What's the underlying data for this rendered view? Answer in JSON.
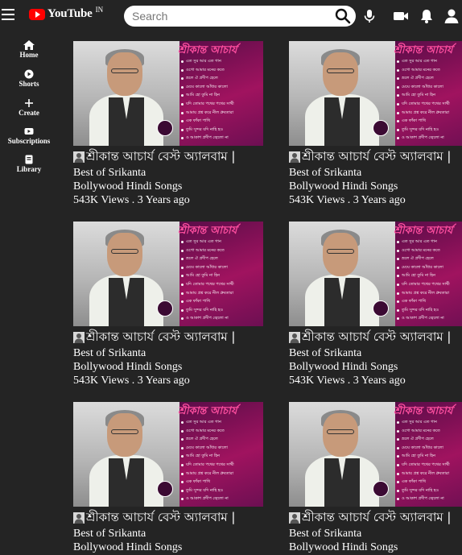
{
  "header": {
    "logo_text": "YouTube",
    "region": "IN",
    "search_placeholder": "Search"
  },
  "sidebar": {
    "items": [
      {
        "label": "Home",
        "icon": "home-icon"
      },
      {
        "label": "Shorts",
        "icon": "shorts-icon"
      },
      {
        "label": "Create",
        "icon": "create-icon"
      },
      {
        "label": "Subscriptions",
        "icon": "subscriptions-icon"
      },
      {
        "label": "Library",
        "icon": "library-icon"
      }
    ]
  },
  "thumbnail_text": {
    "title": "শ্রীকান্ত আচার্য",
    "lines": [
      "এত সুর আর এত গান",
      "ওগো আমার মনের কতে",
      "ভ্রলে ঐ প্রদীপ হেলে",
      "মেঘে কালো আঁধার কালো",
      "আমি হো তুমি না হিন",
      "যদি তোমার পথের পথের সাথী",
      "আমায় প্রশ্ন করে নীল ধ্রুবতারা",
      "এক ফাঁকা পাখি",
      "তুমি সুন্দর যদি নাহি হও",
      "ও আকাশ প্রদীপ জ্বেলো না"
    ]
  },
  "videos": [
    {
      "title": "শ্রীকান্ত আচার্য বেস্ট অ্যালবাম |",
      "line1": "Best of Srikanta",
      "line2": "Bollywood Hindi Songs",
      "meta": "543K Views . 3 Years ago"
    },
    {
      "title": "শ্রীকান্ত আচার্য বেস্ট অ্যালবাম |",
      "line1": "Best of Srikanta",
      "line2": "Bollywood Hindi Songs",
      "meta": "543K Views . 3 Years ago"
    },
    {
      "title": "শ্রীকান্ত আচার্য বেস্ট অ্যালবাম |",
      "line1": "Best of Srikanta",
      "line2": "Bollywood Hindi Songs",
      "meta": "543K Views . 3 Years ago"
    },
    {
      "title": "শ্রীকান্ত আচার্য বেস্ট অ্যালবাম |",
      "line1": "Best of Srikanta",
      "line2": "Bollywood Hindi Songs",
      "meta": "543K Views . 3 Years ago"
    },
    {
      "title": "শ্রীকান্ত আচার্য বেস্ট অ্যালবাম |",
      "line1": "Best of Srikanta",
      "line2": "Bollywood Hindi Songs",
      "meta": ""
    },
    {
      "title": "শ্রীকান্ত আচার্য বেস্ট অ্যালবাম |",
      "line1": "Best of Srikanta",
      "line2": "Bollywood Hindi Songs",
      "meta": ""
    }
  ],
  "colors": {
    "background": "#242424",
    "logo_red": "#ff0000",
    "thumb_magenta": "#a0135f"
  }
}
